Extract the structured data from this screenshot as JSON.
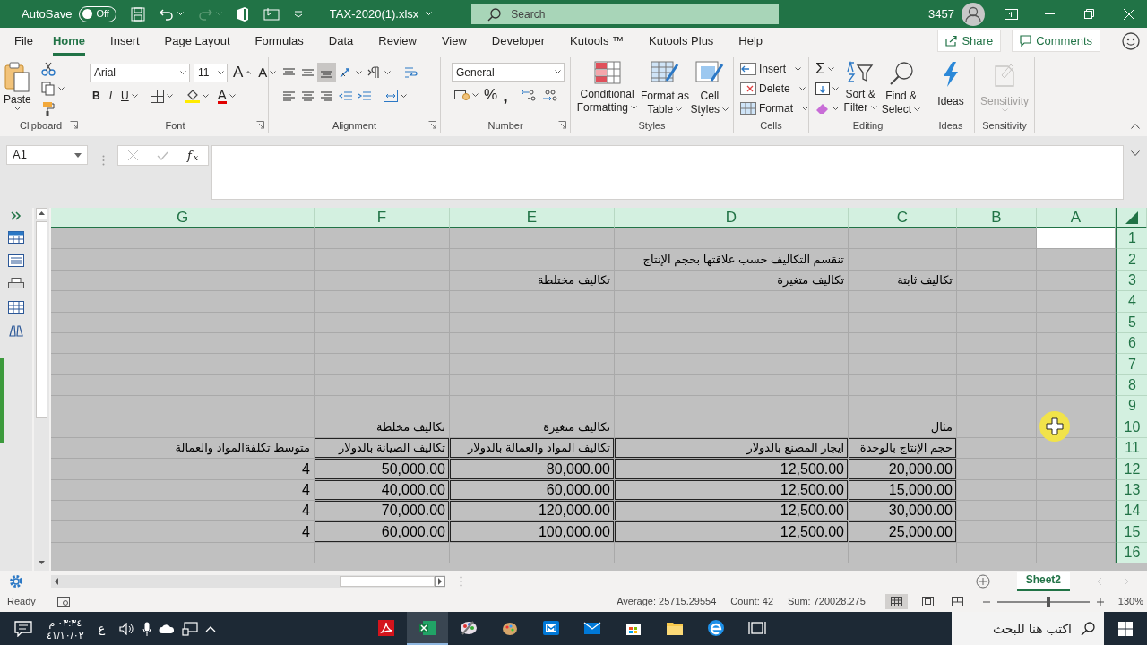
{
  "title_bar": {
    "autosave_label": "AutoSave",
    "autosave": {
      "label": "Off",
      "on": false
    },
    "file_name": "TAX-2020(1).xlsx",
    "search_placeholder": "Search",
    "user_number": "3457"
  },
  "ribbon_tabs": [
    {
      "label": "File",
      "selected": false
    },
    {
      "label": "Home",
      "selected": true
    },
    {
      "label": "Insert",
      "selected": false
    },
    {
      "label": "Page Layout",
      "selected": false
    },
    {
      "label": "Formulas",
      "selected": false
    },
    {
      "label": "Data",
      "selected": false
    },
    {
      "label": "Review",
      "selected": false
    },
    {
      "label": "View",
      "selected": false
    },
    {
      "label": "Developer",
      "selected": false
    },
    {
      "label": "Kutools ™",
      "selected": false
    },
    {
      "label": "Kutools Plus",
      "selected": false
    },
    {
      "label": "Help",
      "selected": false
    }
  ],
  "share_button": "Share",
  "comments_button": "Comments",
  "ribbon": {
    "clipboard": {
      "label": "Clipboard",
      "paste": "Paste"
    },
    "font": {
      "label": "Font",
      "font_name": "Arial",
      "font_size": "11",
      "grow": "A",
      "shrink": "A",
      "bold": "B",
      "italic": "I",
      "underline": "U",
      "font_color": "A"
    },
    "alignment": {
      "label": "Alignment"
    },
    "number": {
      "label": "Number",
      "format": "General",
      "percent": "%",
      "comma": ","
    },
    "styles": {
      "label": "Styles",
      "buttons": [
        "Conditional Formatting",
        "Format as Table",
        "Cell Styles"
      ]
    },
    "cells": {
      "label": "Cells",
      "buttons": [
        "Insert",
        "Delete",
        "Format"
      ]
    },
    "editing": {
      "label": "Editing",
      "autosum": "Σ",
      "buttons": [
        "Sort & Filter",
        "Find & Select"
      ]
    },
    "ideas": {
      "label": "Ideas",
      "button": "Ideas"
    },
    "sensitivity": {
      "label": "Sensitivity",
      "button": "Sensitivity",
      "disabled": true
    }
  },
  "formula_bar": {
    "name_box": "A1",
    "insert_function": "f$_{x}$"
  },
  "sheet": {
    "columns": [
      {
        "letter": "G",
        "in_table": false,
        "active": false
      },
      {
        "letter": "F",
        "in_table": true,
        "active": false
      },
      {
        "letter": "E",
        "in_table": true,
        "active": false
      },
      {
        "letter": "D",
        "in_table": true,
        "active": false
      },
      {
        "letter": "C",
        "in_table": true,
        "active": false
      },
      {
        "letter": "B",
        "in_table": false,
        "active": false
      },
      {
        "letter": "A",
        "in_table": false,
        "active": true
      }
    ],
    "rows": [
      {
        "number": "1",
        "in_table": false,
        "active": true
      },
      {
        "number": "2",
        "in_table": false,
        "cells": {
          "D": "تنقسم التكاليف حسب علاقتها بحجم الإنتاج"
        }
      },
      {
        "number": "3",
        "in_table": false,
        "cells": {
          "E": "تكاليف مختلطة",
          "D": "تكاليف متغيرة",
          "C": "تكاليف ثابتة"
        }
      },
      {
        "number": "4",
        "in_table": false
      },
      {
        "number": "5",
        "in_table": false
      },
      {
        "number": "6",
        "in_table": false
      },
      {
        "number": "7",
        "in_table": false
      },
      {
        "number": "8",
        "in_table": false
      },
      {
        "number": "9",
        "in_table": false
      },
      {
        "number": "10",
        "in_table": false,
        "cells": {
          "F": "تكاليف مخلطة",
          "E": "تكاليف متغيرة",
          "C": "مثال"
        }
      },
      {
        "number": "11",
        "in_table": true,
        "cells": {
          "G": "متوسط تكلفةالمواد والعمالة",
          "F": "تكاليف الصيانة بالدولار",
          "E": "تكاليف المواد والعمالة بالدولار",
          "D": "ايجار المصنع بالدولار",
          "C": "حجم الإنتاج بالوحدة"
        }
      },
      {
        "number": "12",
        "in_table": true,
        "cells": {
          "G": "4",
          "F": "50,000.00",
          "E": "80,000.00",
          "D": "12,500.00",
          "C": "20,000.00"
        }
      },
      {
        "number": "13",
        "in_table": true,
        "cells": {
          "G": "4",
          "F": "40,000.00",
          "E": "60,000.00",
          "D": "12,500.00",
          "C": "15,000.00"
        }
      },
      {
        "number": "14",
        "in_table": true,
        "cells": {
          "G": "4",
          "F": "70,000.00",
          "E": "120,000.00",
          "D": "12,500.00",
          "C": "30,000.00"
        }
      },
      {
        "number": "15",
        "in_table": true,
        "cells": {
          "G": "4",
          "F": "60,000.00",
          "E": "100,000.00",
          "D": "12,500.00",
          "C": "25,000.00"
        }
      },
      {
        "number": "16",
        "in_table": false
      }
    ]
  },
  "sheet_tabs": [
    {
      "label": "Sheet2",
      "selected": true
    }
  ],
  "status_bar": {
    "mode": "Ready",
    "average": "Average: 25715.29554",
    "count": "Count: 42",
    "sum": "Sum: 720028.275",
    "zoom": "130%",
    "zoom_slider": {
      "level": 0.55
    }
  },
  "taskbar": {
    "time": "٠٣:٣٤ م",
    "date": "٤١/١٠/٠٢",
    "language": "ع",
    "search_placeholder": "اكتب هنا للبحث",
    "apps": [
      {
        "selected": false
      },
      {
        "selected": true
      },
      {
        "selected": false
      },
      {
        "selected": false
      },
      {
        "selected": false
      },
      {
        "selected": false
      },
      {
        "selected": false
      },
      {
        "selected": false
      },
      {
        "selected": false
      },
      {
        "selected": false
      }
    ]
  }
}
